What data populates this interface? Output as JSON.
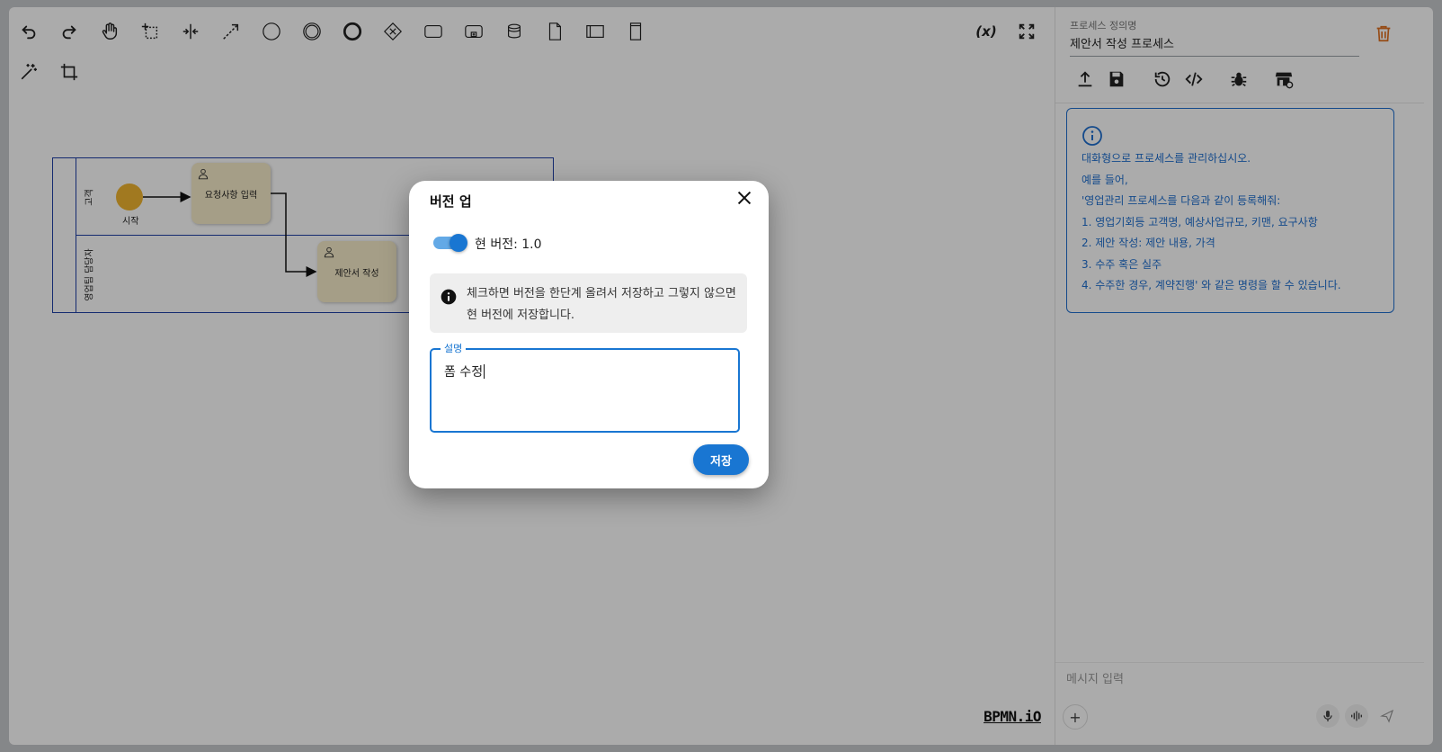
{
  "toolbar": {
    "row1": [
      "undo-icon",
      "redo-icon",
      "hand-tool-icon",
      "lasso-tool-icon",
      "space-tool-icon",
      "global-connect-icon",
      "start-event-icon",
      "intermediate-event-icon",
      "end-event-icon",
      "gateway-icon",
      "task-icon",
      "subprocess-icon",
      "data-store-icon",
      "data-object-icon",
      "pool-icon",
      "lane-icon"
    ],
    "row2": [
      "magic-wand-icon",
      "crop-icon"
    ],
    "variables_label": "(x)",
    "fullscreen_icon": "fullscreen-icon"
  },
  "diagram": {
    "lanes": [
      "고객",
      "영업팀 담당자"
    ],
    "start_event_label": "시작",
    "tasks": [
      "요청사항 입력",
      "제안서 작성"
    ],
    "logo": "BPMN.iO"
  },
  "panel": {
    "process_name_label": "프로세스 정의명",
    "process_name_value": "제안서 작성 프로세스",
    "info_lines": [
      "대화형으로 프로세스를 관리하십시오.",
      "예를 들어,",
      "'영업관리 프로세스를 다음과 같이 등록해줘:",
      "1. 영업기회등 고객명, 예상사업규모, 키맨, 요구사항",
      "2. 제안 작성: 제안 내용, 가격",
      "3. 수주 혹은 실주",
      "4. 수주한 경우, 계약진행' 와 같은 명령을 할 수 있습니다."
    ],
    "chat_placeholder": "메시지 입력",
    "add_label": "+"
  },
  "dialog": {
    "title": "버전 업",
    "toggle_label": "현 버전: 1.0",
    "toggle_on": true,
    "alert_text": "체크하면 버전을 한단계 올려서 저장하고 그렇지 않으면 현 버전에 저장합니다.",
    "field_label": "설명",
    "field_value": "폼 수정",
    "save_label": "저장"
  },
  "colors": {
    "accent": "#1976d2",
    "pool_border": "#1f3fa7",
    "start_event": "#f1b530",
    "task_fill": "#f7ecc9",
    "trash": "#e07020",
    "info": "#1e6fd0"
  }
}
